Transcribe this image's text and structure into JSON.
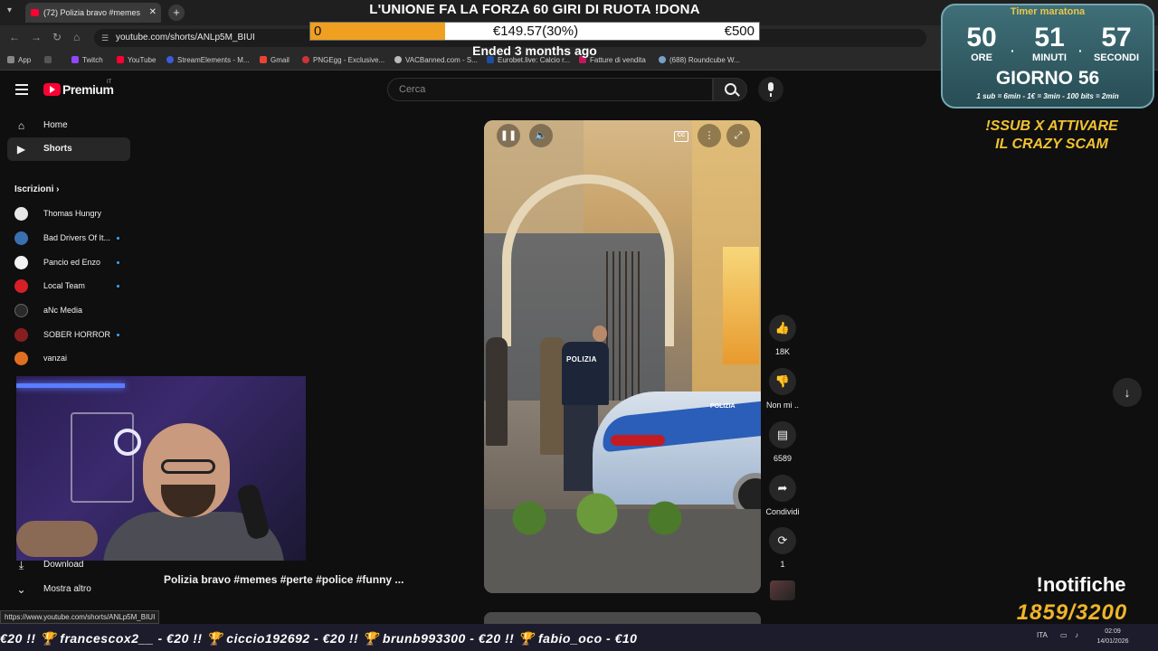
{
  "browser": {
    "tab_title": "(72) Polizia bravo #memes",
    "url": "youtube.com/shorts/ANLp5M_BIUI",
    "bookmarks": [
      "App",
      "Twitch",
      "YouTube",
      "StreamElements - M...",
      "Gmail",
      "PNGEgg - Exclusive...",
      "VACBanned.com - S...",
      "Eurobet.live: Calcio r...",
      "Fatture di vendita",
      "(688) Roundcube W..."
    ]
  },
  "youtube": {
    "logo_text": "Premium",
    "country_code": "IT",
    "search_placeholder": "Cerca"
  },
  "sidebar": {
    "items": [
      {
        "label": "Home",
        "icon": "home-icon"
      },
      {
        "label": "Shorts",
        "icon": "shorts-icon"
      }
    ],
    "subscriptions_title": "Iscrizioni",
    "subscriptions": [
      {
        "label": "Thomas Hungry",
        "color": "#e8e8e8",
        "new": false
      },
      {
        "label": "Bad Drivers Of It...",
        "color": "#3a6fb0",
        "new": true
      },
      {
        "label": "Pancio ed Enzo",
        "color": "#f2f2f2",
        "new": true
      },
      {
        "label": "Local Team",
        "color": "#d61f26",
        "new": true
      },
      {
        "label": "aNc Media",
        "color": "#2a2a2a",
        "new": false
      },
      {
        "label": "SOBER HORROR ...",
        "color": "#8a1e1e",
        "new": true
      },
      {
        "label": "vanzai",
        "color": "#e07020",
        "new": false
      }
    ],
    "download_label": "Download",
    "more_label": "Mostra altro"
  },
  "short": {
    "title": "Polizia bravo #memes #perte #police #funny ...",
    "overlay_officer": "POLIZIA",
    "overlay_car": "POLIZIA"
  },
  "actions": {
    "like_count": "18K",
    "dislike_label": "Non mi ..",
    "comments_count": "6589",
    "share_label": "Condividi",
    "remix_count": "1"
  },
  "stream": {
    "goal_title": "L'UNIONE FA LA FORZA 60 GIRI DI RUOTA !DONA",
    "goal_start": "0",
    "goal_current": "€149.57(30%)",
    "goal_end": "€500",
    "goal_progress": 0.3,
    "goal_status": "Ended 3 months ago",
    "timer_title": "Timer maratona",
    "timer_hours": "50",
    "timer_minutes": "51",
    "timer_seconds": "57",
    "timer_hours_label": "ORE",
    "timer_minutes_label": "MINUTI",
    "timer_seconds_label": "SECONDI",
    "timer_day": "GIORNO 56",
    "timer_rule": "1 sub = 6min - 1€ = 3min - 100 bits = 2min",
    "sub_promo": "!SSUB X ATTIVARE IL CRAZY SCAM",
    "notifiche": "!notifiche",
    "sub_goal": "1859/3200",
    "ticker": "€20   !! 🏆 francescox2__ - €20   !! 🏆 ciccio192692 - €20   !! 🏆 brunb993300 - €20   !! 🏆 fabio_oco - €10"
  },
  "status_url": "https://www.youtube.com/shorts/ANLp5M_BIUI",
  "taskbar": {
    "language": "ITA",
    "time": "02:09",
    "date": "14/01/2026"
  },
  "colors": {
    "goal_fill": "#f0a020",
    "accent": "#ff0033",
    "timer_bg": "#3f6f78"
  }
}
